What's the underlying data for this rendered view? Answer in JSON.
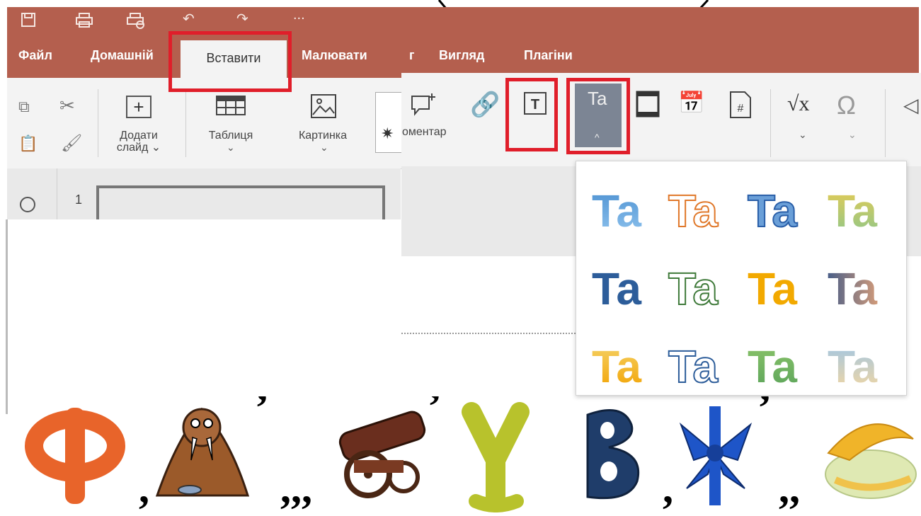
{
  "quick_access": {
    "more": "..."
  },
  "menu": {
    "file": "Файл",
    "home": "Домашній",
    "insert": "Вставити",
    "draw": "Малювати",
    "cut_letter": "г",
    "view": "Вигляд",
    "plugins": "Плагіни"
  },
  "toolbar": {
    "add_slide": "Додати",
    "add_slide_2": "слайд ⌄",
    "table": "Таблиця",
    "picture": "Картинка",
    "comment": "оментар"
  },
  "slides": {
    "num": "1"
  },
  "wordart": {
    "sample": "Ta"
  },
  "colors": {
    "accent": "#b45f4e",
    "highlight": "#e01e2a"
  }
}
